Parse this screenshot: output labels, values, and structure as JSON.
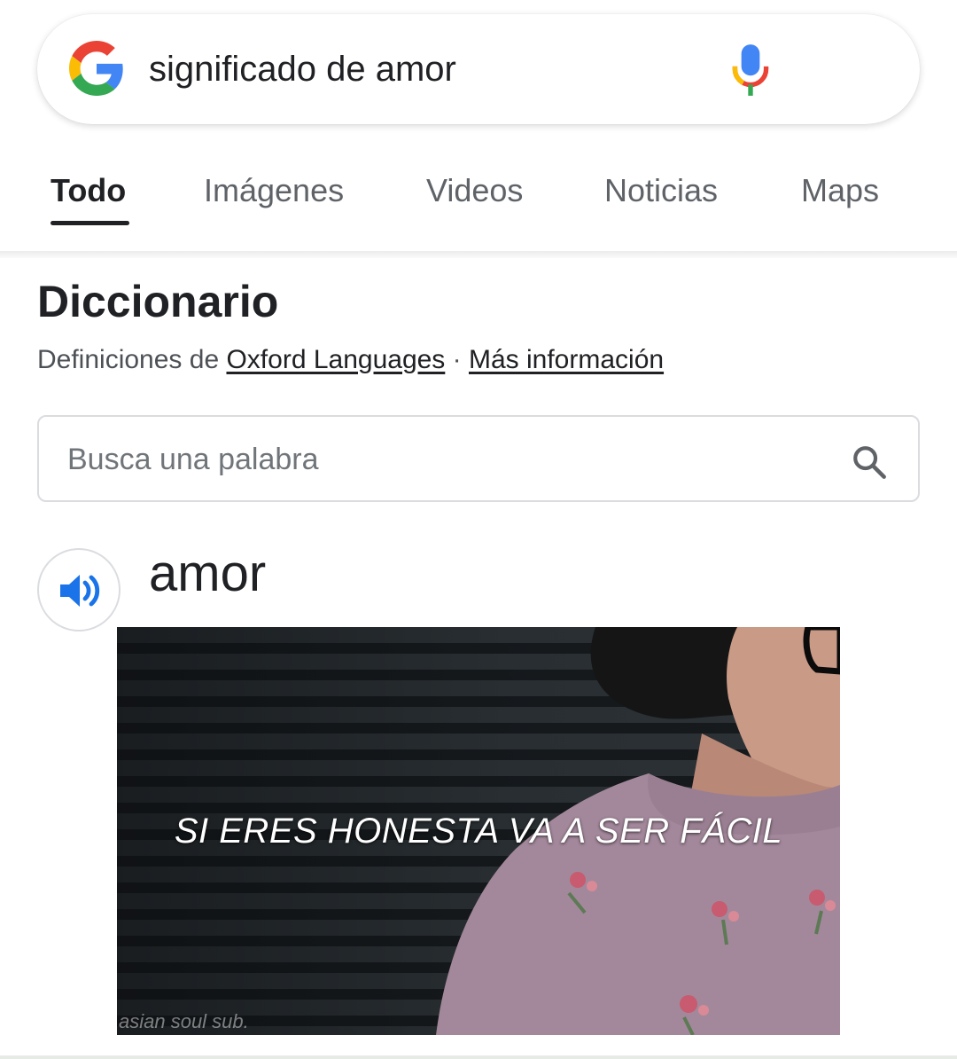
{
  "search": {
    "query": "significado de amor"
  },
  "tabs": [
    {
      "label": "Todo",
      "active": true
    },
    {
      "label": "Imágenes"
    },
    {
      "label": "Videos"
    },
    {
      "label": "Noticias"
    },
    {
      "label": "Maps"
    }
  ],
  "dictionary": {
    "title": "Diccionario",
    "source_prefix": "Definiciones de ",
    "source_link": "Oxford Languages",
    "separator": " · ",
    "more_info": "Más información",
    "word_search_placeholder": "Busca una palabra",
    "headword": "amor"
  },
  "video_overlay": {
    "subtitle": "SI ERES HONESTA VA A SER FÁCIL",
    "watermark": "asian soul sub."
  },
  "colors": {
    "google_blue": "#4285F4",
    "google_red": "#EA4335",
    "google_yellow": "#FBBC05",
    "google_green": "#34A853",
    "speaker_blue": "#1a73e8"
  }
}
